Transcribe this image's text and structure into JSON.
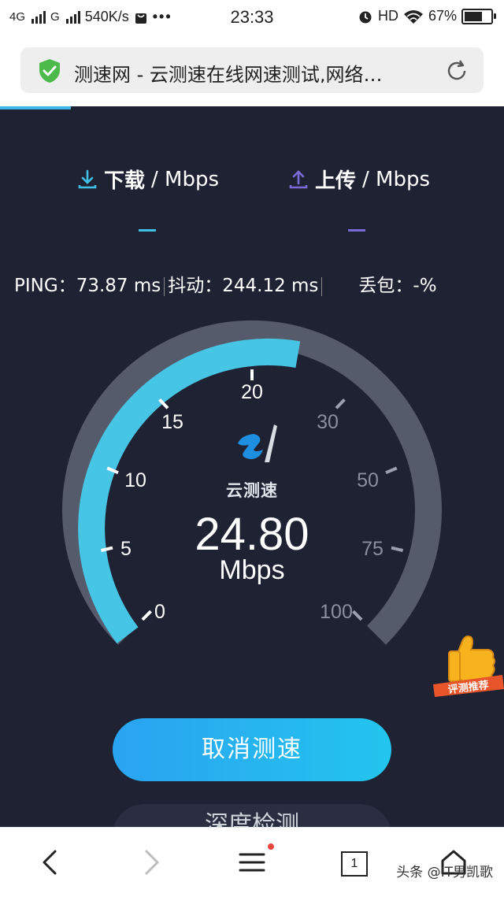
{
  "status_bar": {
    "net1": "4G",
    "net2": "G",
    "speed": "540K/s",
    "more": "•••",
    "time": "23:33",
    "hd": "HD",
    "battery": "67%"
  },
  "url_bar": {
    "title": "测速网 - 云测速在线网速测试,网络…"
  },
  "header": {
    "download_label": "下载",
    "download_unit": "/ Mbps",
    "upload_label": "上传",
    "upload_unit": "/ Mbps"
  },
  "stats": {
    "ping_label": "PING：",
    "ping_value": "73.87 ms",
    "jitter_label": "抖动：",
    "jitter_value": "244.12 ms",
    "loss_label": "丢包：",
    "loss_value": "-%"
  },
  "gauge": {
    "value": "24.80",
    "unit": "Mbps",
    "brand": "云测速",
    "tick_labels": [
      "0",
      "5",
      "10",
      "15",
      "20",
      "30",
      "50",
      "75",
      "100"
    ],
    "active_color": "#46c6e4",
    "inactive_color": "#565b6c"
  },
  "badge": {
    "text": "评测推荐"
  },
  "buttons": {
    "cancel": "取消测速",
    "second": "深度检测"
  },
  "bottom_nav": {
    "tabs_count": "1",
    "watermark": "头条 @IT男凯歌"
  },
  "colors": {
    "background": "#1f2233",
    "download_accent": "#3fc1e6",
    "upload_accent": "#7a6ad8",
    "button_gradient_start": "#2aa3f0",
    "button_gradient_end": "#23c5ee"
  }
}
